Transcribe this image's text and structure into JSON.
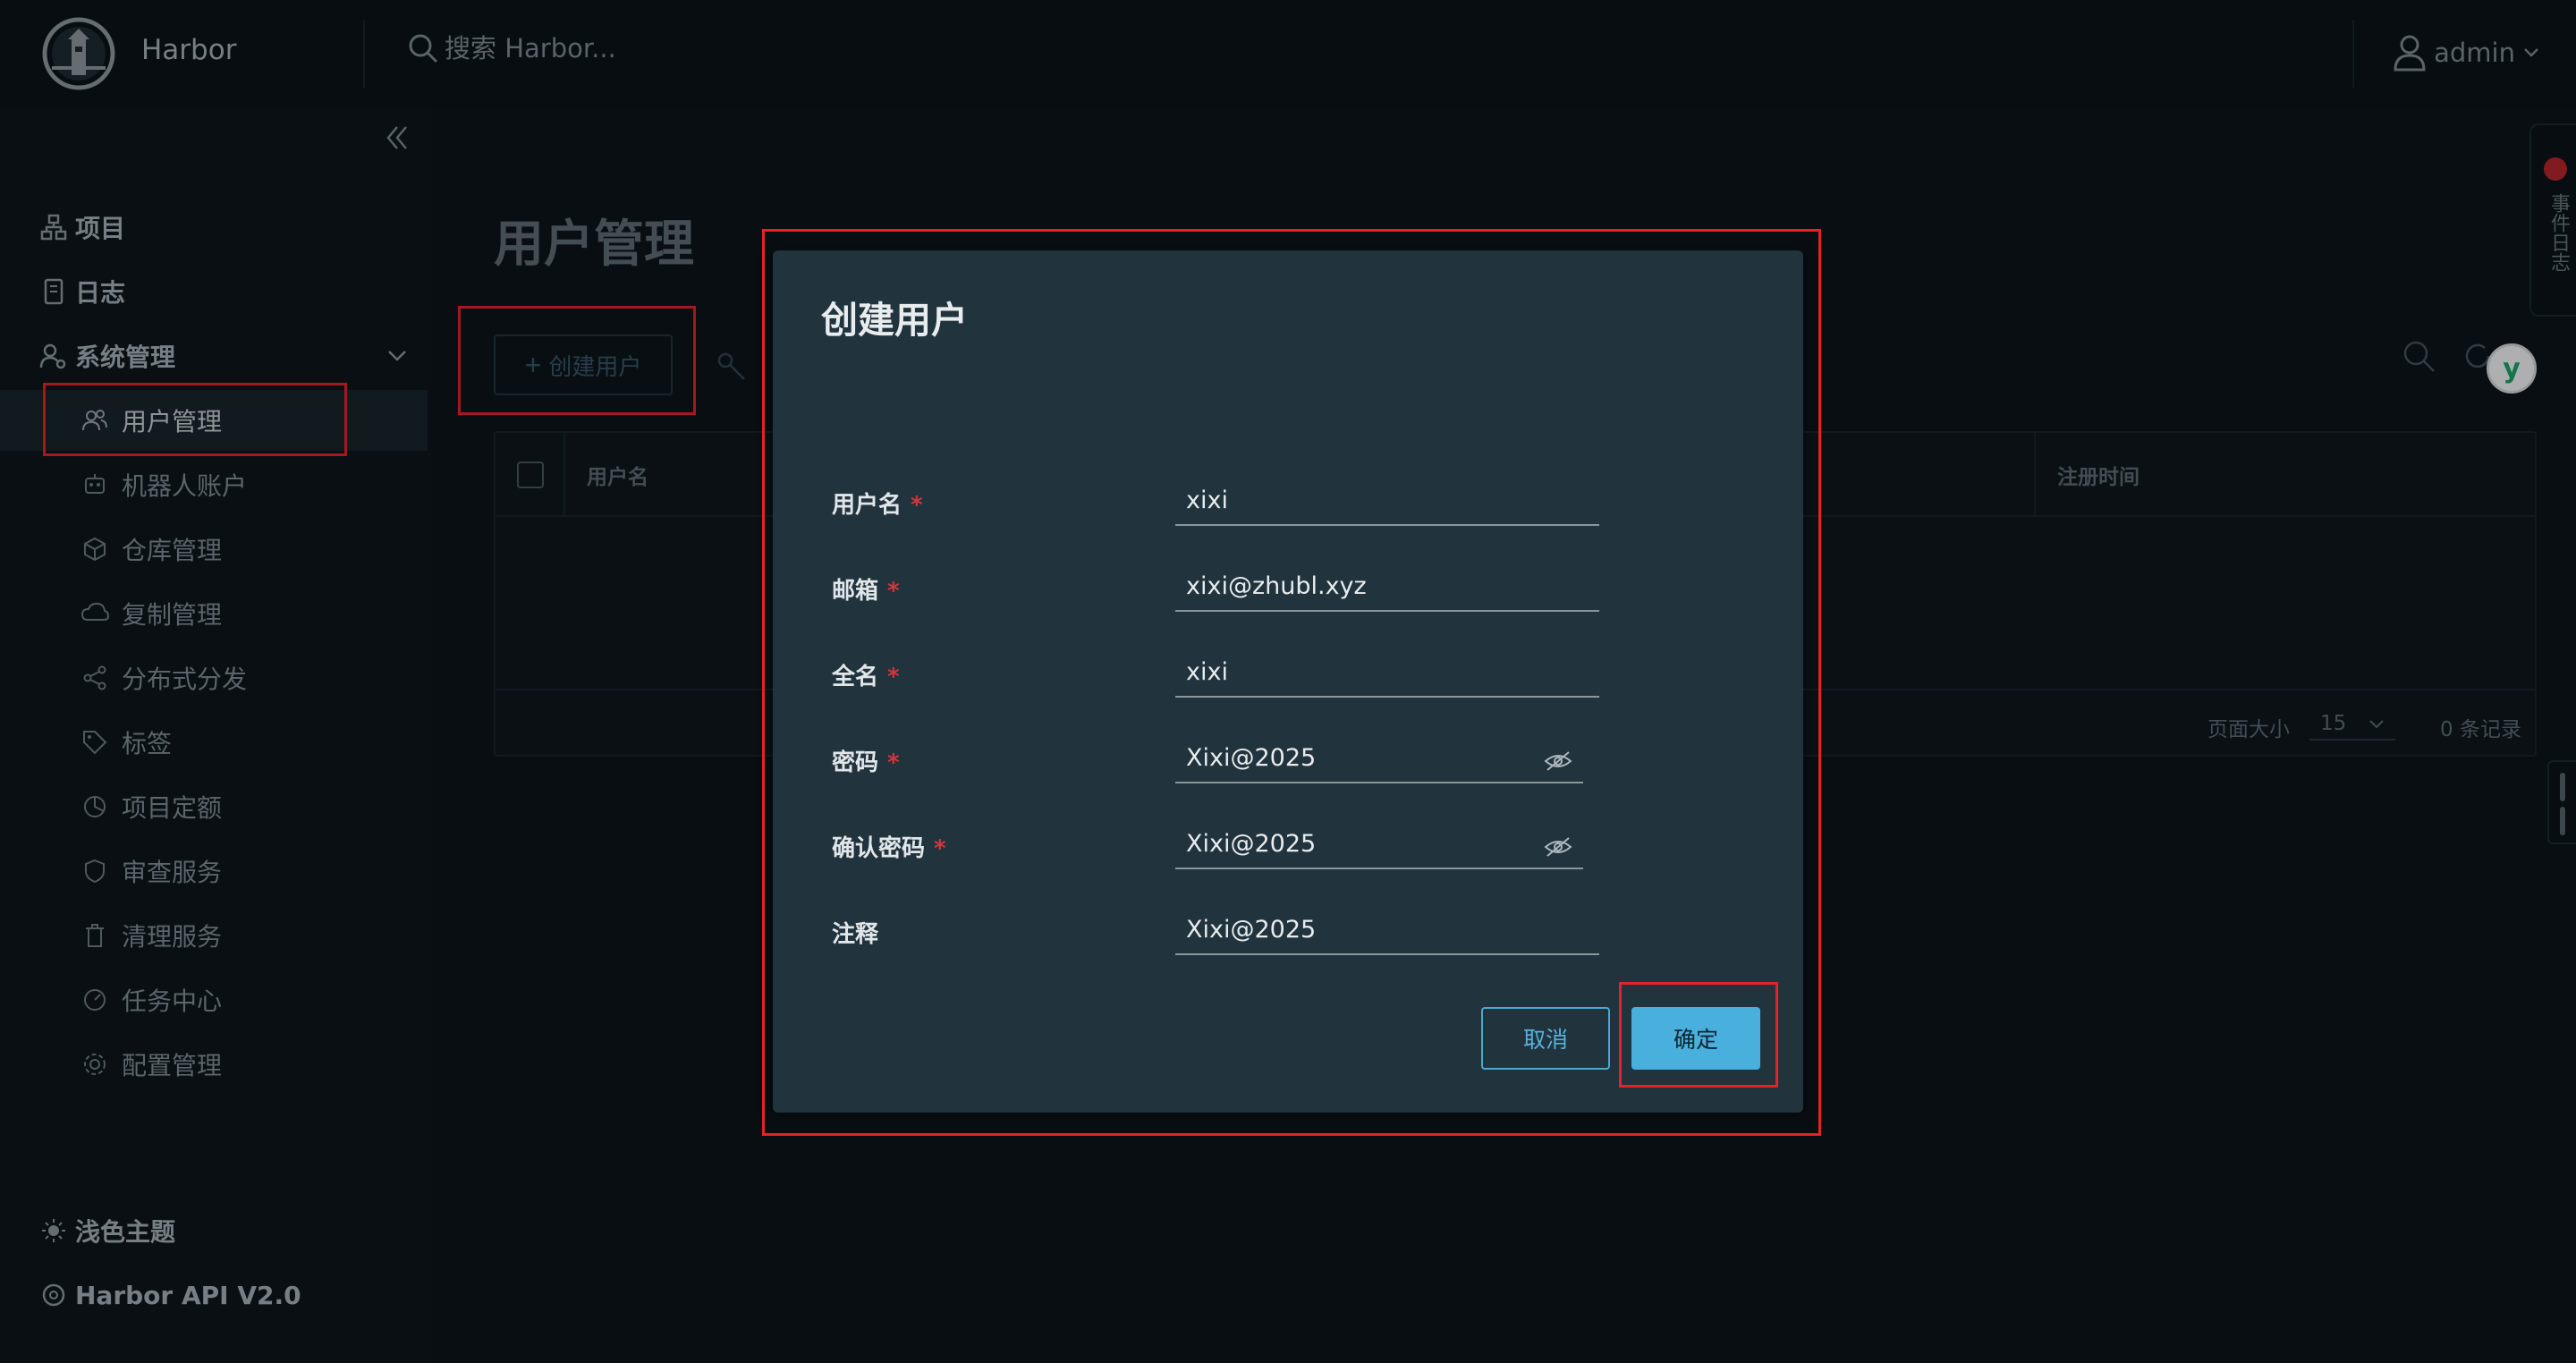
{
  "header": {
    "brand": "Harbor",
    "search_placeholder": "搜索 Harbor...",
    "user": "admin"
  },
  "sidebar": {
    "items": [
      {
        "label": "项目",
        "icon": "sitemap-icon"
      },
      {
        "label": "日志",
        "icon": "log-icon"
      },
      {
        "label": "系统管理",
        "icon": "users-cog-icon"
      }
    ],
    "sub_items": [
      {
        "label": "用户管理",
        "icon": "users-icon"
      },
      {
        "label": "机器人账户",
        "icon": "robot-icon"
      },
      {
        "label": "仓库管理",
        "icon": "cube-icon"
      },
      {
        "label": "复制管理",
        "icon": "cloud-sync-icon"
      },
      {
        "label": "分布式分发",
        "icon": "share-icon"
      },
      {
        "label": "标签",
        "icon": "tag-icon"
      },
      {
        "label": "项目定额",
        "icon": "pie-chart-icon"
      },
      {
        "label": "审查服务",
        "icon": "shield-icon"
      },
      {
        "label": "清理服务",
        "icon": "trash-icon"
      },
      {
        "label": "任务中心",
        "icon": "dashboard-icon"
      },
      {
        "label": "配置管理",
        "icon": "gear-icon"
      }
    ],
    "footer": [
      {
        "label": "浅色主题",
        "icon": "sun-icon"
      },
      {
        "label": "Harbor API V2.0",
        "icon": "api-icon"
      }
    ]
  },
  "main": {
    "title": "用户管理",
    "create_button": "创建用户",
    "columns": [
      "用户名",
      "注册时间"
    ],
    "page_size_label": "页面大小",
    "page_size": "15",
    "records": "0 条记录"
  },
  "side_tab": {
    "label": "事件日志"
  },
  "modal": {
    "title": "创建用户",
    "fields": [
      {
        "label": "用户名",
        "value": "xixi",
        "required": "*"
      },
      {
        "label": "邮箱",
        "value": "xixi@zhubl.xyz",
        "required": "*"
      },
      {
        "label": "全名",
        "value": "xixi",
        "required": "*"
      },
      {
        "label": "密码",
        "value": "Xixi@2025",
        "required": "*"
      },
      {
        "label": "确认密码",
        "value": "Xixi@2025",
        "required": "*"
      },
      {
        "label": "注释",
        "value": "Xixi@2025"
      }
    ],
    "cancel": "取消",
    "confirm": "确定"
  },
  "colors": {
    "accent": "#49afdc",
    "highlight": "#e3222a",
    "modal_bg": "#21333d"
  }
}
